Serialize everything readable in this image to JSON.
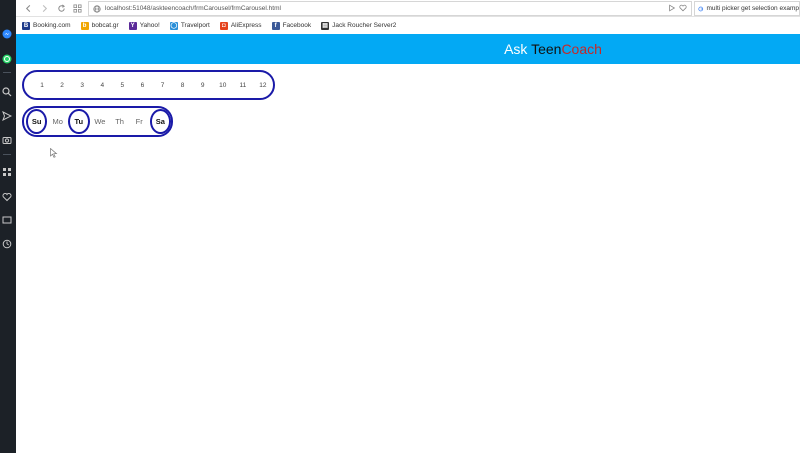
{
  "browser": {
    "url": "localhost:51048/askteencoach/frmCarousel/frmCarousel.html",
    "search_text": "multi picker get selection examp",
    "bookmarks": [
      {
        "label": "Booking.com",
        "icon": "booking-icon",
        "color": "#1e3b8a",
        "glyph": "B"
      },
      {
        "label": "bobcat.gr",
        "icon": "bobcat-icon",
        "color": "#f0a500",
        "glyph": "b"
      },
      {
        "label": "Yahoo!",
        "icon": "yahoo-icon",
        "color": "#5b2b99",
        "glyph": "Y"
      },
      {
        "label": "Travelport",
        "icon": "travelport-icon",
        "color": "#2a8fd8",
        "glyph": "◯"
      },
      {
        "label": "AliExpress",
        "icon": "aliexpress-icon",
        "color": "#e5421c",
        "glyph": "◘"
      },
      {
        "label": "Facebook",
        "icon": "facebook-icon",
        "color": "#3b5998",
        "glyph": "f"
      },
      {
        "label": "Jack Roucher Server2",
        "icon": "printer-icon",
        "color": "#333333",
        "glyph": "▤"
      }
    ]
  },
  "app": {
    "brand_ask": "Ask",
    "brand_teen": "Teen",
    "brand_coach": "Coach",
    "header_color": "#03a9f4"
  },
  "months": [
    "1",
    "2",
    "3",
    "4",
    "5",
    "6",
    "7",
    "8",
    "9",
    "10",
    "11",
    "12"
  ],
  "days": [
    {
      "label": "Su",
      "selected": true
    },
    {
      "label": "Mo",
      "selected": false
    },
    {
      "label": "Tu",
      "selected": true
    },
    {
      "label": "We",
      "selected": false
    },
    {
      "label": "Th",
      "selected": false
    },
    {
      "label": "Fr",
      "selected": false
    },
    {
      "label": "Sa",
      "selected": true
    }
  ]
}
